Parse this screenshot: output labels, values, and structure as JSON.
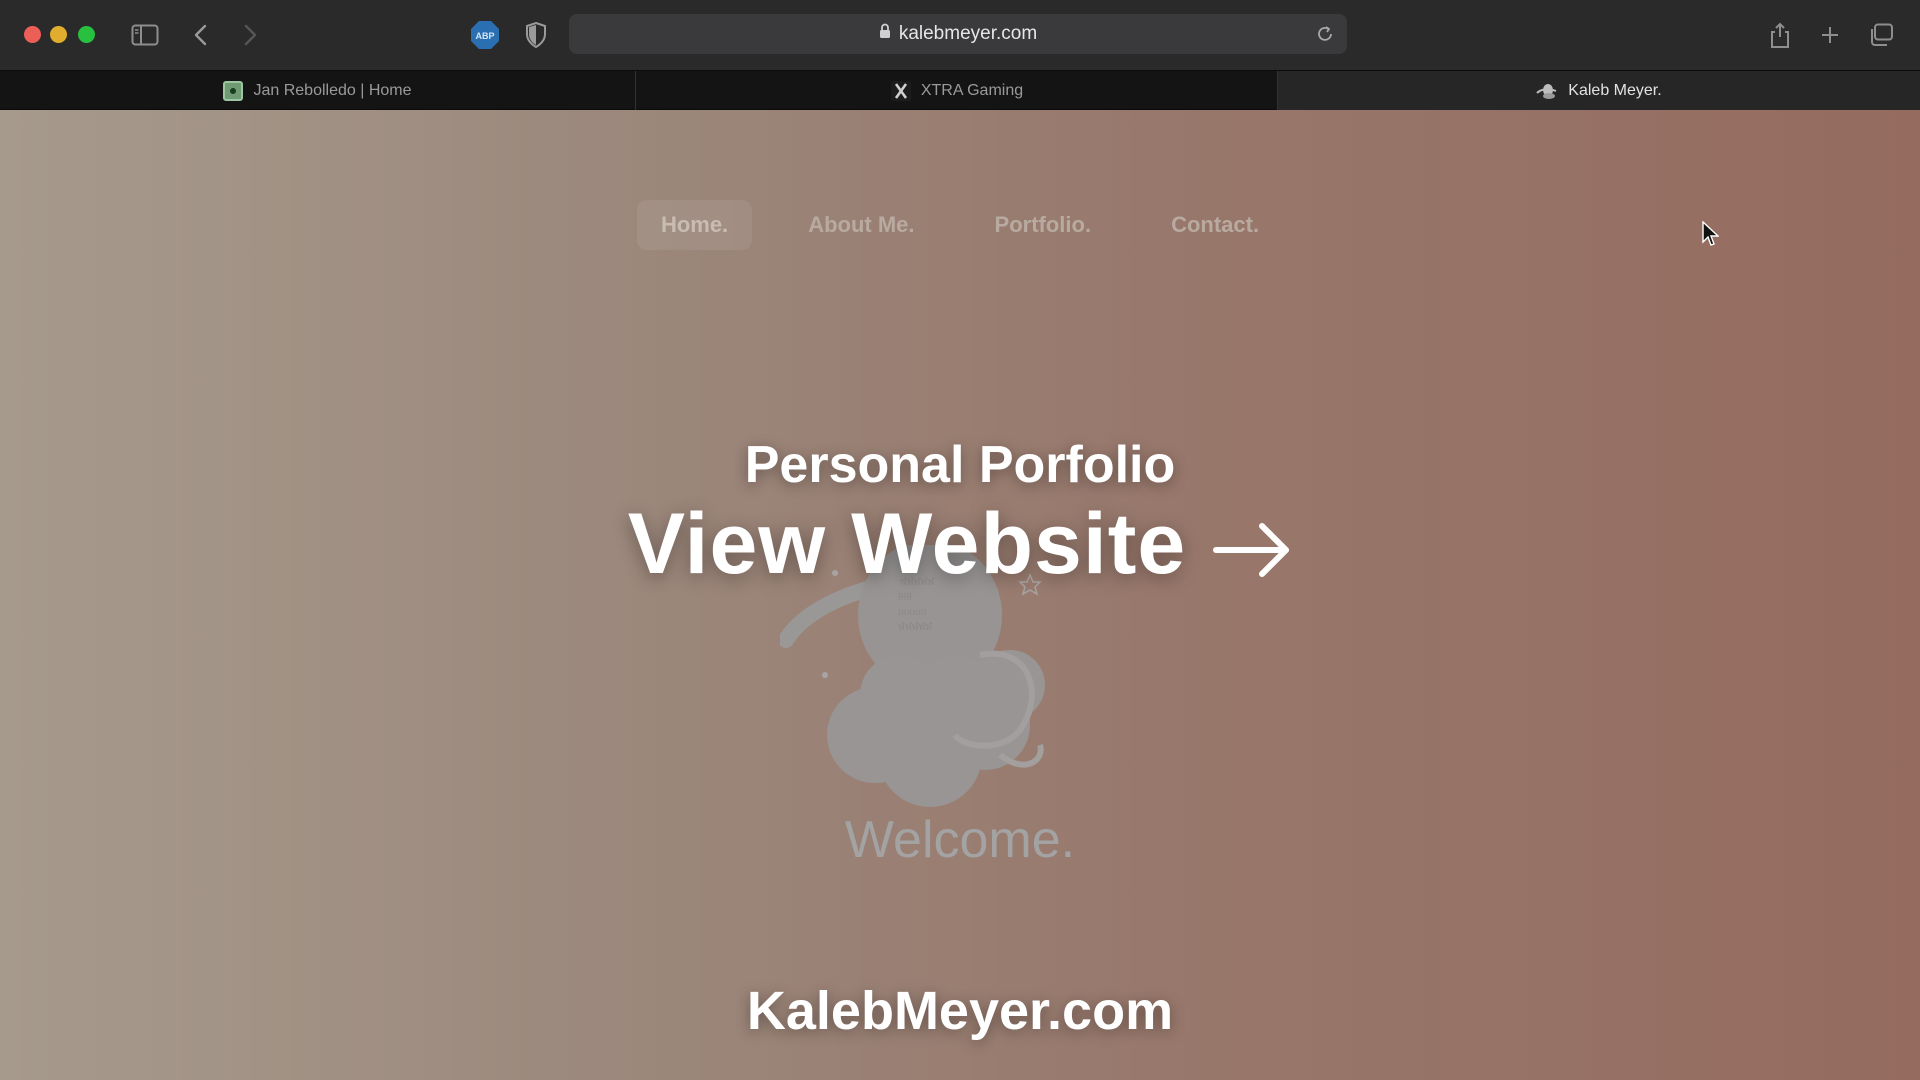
{
  "browser": {
    "address": {
      "url": "kalebmeyer.com"
    },
    "tabs": [
      {
        "title": "Jan Rebolledo | Home",
        "icon": "green-camera-favicon"
      },
      {
        "title": "XTRA Gaming",
        "icon": "x-favicon"
      },
      {
        "title": "Kaleb Meyer.",
        "icon": "astronaut-favicon",
        "active": true
      }
    ],
    "toolbar_icons": [
      "sidebar-icon",
      "back-icon",
      "forward-icon",
      "abp-icon",
      "shield-icon",
      "reload-icon",
      "share-icon",
      "new-tab-icon",
      "tab-overview-icon"
    ],
    "abp_label": "ABP"
  },
  "page": {
    "nav": [
      {
        "label": "Home.",
        "active": true
      },
      {
        "label": "About Me.",
        "active": false
      },
      {
        "label": "Portfolio.",
        "active": false
      },
      {
        "label": "Contact.",
        "active": false
      }
    ],
    "welcome": "Welcome."
  },
  "overlay": {
    "subtitle": "Personal Porfolio",
    "cta": "View Website",
    "url": "KalebMeyer.com"
  },
  "colors": {
    "gradient_start": "#a69a8c",
    "gradient_end": "#956b5f",
    "chrome": "#2a2a2b",
    "traffic_close": "#ec5f57",
    "traffic_min": "#e0ad2f",
    "traffic_max": "#28c03f"
  }
}
